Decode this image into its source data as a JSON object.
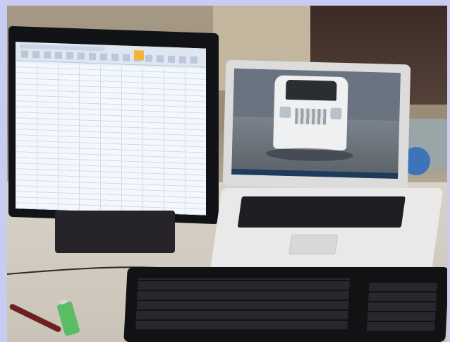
{
  "scene": {
    "monitor": {
      "content": "spreadsheet"
    },
    "laptop": {
      "content": "video-feed"
    }
  }
}
